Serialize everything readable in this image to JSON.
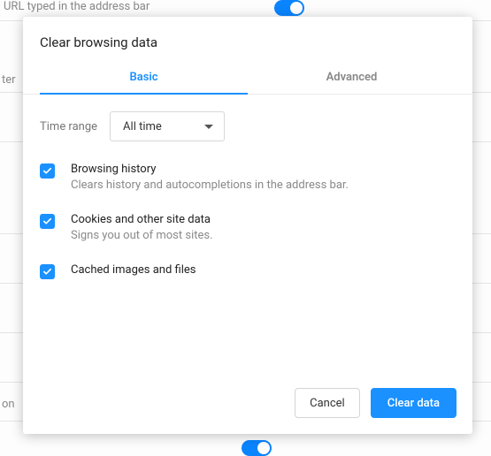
{
  "modal": {
    "title": "Clear browsing data",
    "tabs": {
      "basic": "Basic",
      "advanced": "Advanced",
      "active": "basic"
    },
    "timeRange": {
      "label": "Time range",
      "value": "All time"
    },
    "options": [
      {
        "key": "history",
        "title": "Browsing history",
        "desc": "Clears history and autocompletions in the address bar.",
        "checked": true
      },
      {
        "key": "cookies",
        "title": "Cookies and other site data",
        "desc": "Signs you out of most sites.",
        "checked": true
      },
      {
        "key": "cache",
        "title": "Cached images and files",
        "desc": "",
        "checked": true
      }
    ],
    "buttons": {
      "cancel": "Cancel",
      "clear": "Clear data"
    }
  },
  "bg": {
    "urlText": "URL typed in the address bar",
    "sideLabel1": "ter",
    "sideLabel2": "on"
  }
}
